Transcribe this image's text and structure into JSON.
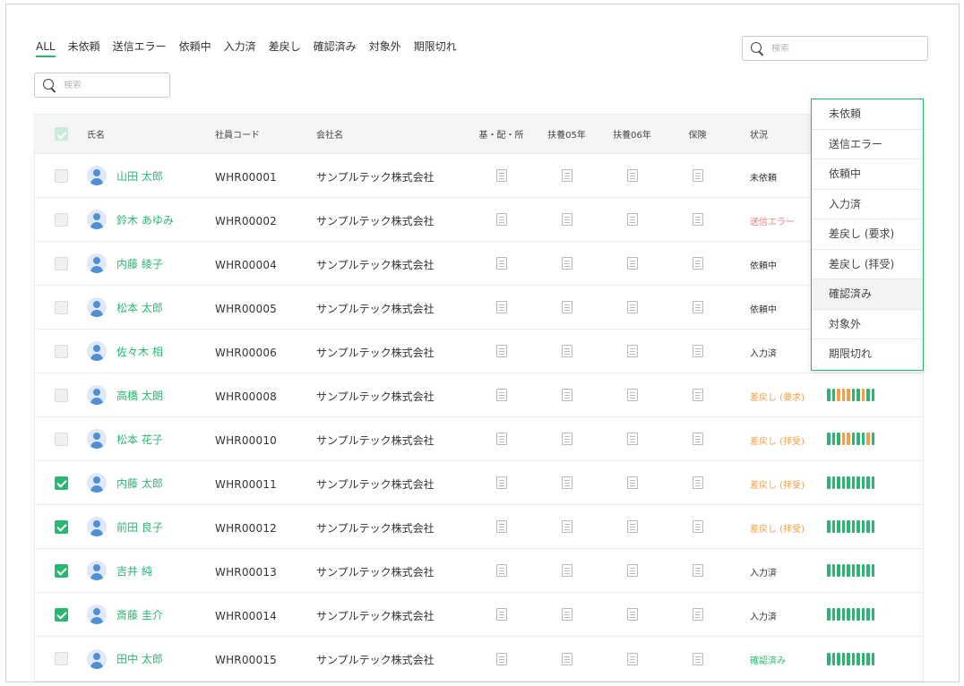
{
  "tabs": [
    "ALL",
    "未依頼",
    "送信エラー",
    "依頼中",
    "入力済",
    "差戻し",
    "確認済み",
    "対象外",
    "期限切れ"
  ],
  "active_tab": 0,
  "search_top": {
    "placeholder": "検索"
  },
  "search_left": {
    "placeholder": "検索"
  },
  "columns": {
    "name": "氏名",
    "code": "社員コード",
    "company": "会社名",
    "doc1": "基・配・所",
    "doc2": "扶養05年",
    "doc3": "扶養06年",
    "doc4": "保険",
    "status": "状況"
  },
  "colors": {
    "accent": "#2bb673",
    "error": "#f07e7e",
    "warn": "#f0a04b",
    "confirmed": "#2bb673",
    "normal": "#333333"
  },
  "icons": {
    "document": "document-icon",
    "avatar": "avatar-icon",
    "search": "search-icon"
  },
  "rows": [
    {
      "checked": false,
      "name": "山田 太郎",
      "code": "WHR00001",
      "company": "サンプルテック株式会社",
      "status": "未依頼",
      "status_type": "normal",
      "progress": null
    },
    {
      "checked": false,
      "name": "鈴木 あゆみ",
      "code": "WHR00002",
      "company": "サンプルテック株式会社",
      "status": "送信エラー",
      "status_type": "error",
      "progress": null
    },
    {
      "checked": false,
      "name": "内藤 綾子",
      "code": "WHR00004",
      "company": "サンプルテック株式会社",
      "status": "依頼中",
      "status_type": "normal",
      "progress": null
    },
    {
      "checked": false,
      "name": "松本 太郎",
      "code": "WHR00005",
      "company": "サンプルテック株式会社",
      "status": "依頼中",
      "status_type": "normal",
      "progress": null
    },
    {
      "checked": false,
      "name": "佐々木 相",
      "code": "WHR00006",
      "company": "サンプルテック株式会社",
      "status": "入力済",
      "status_type": "normal",
      "progress": null
    },
    {
      "checked": false,
      "name": "高橋 太朗",
      "code": "WHR00008",
      "company": "サンプルテック株式会社",
      "status": "差戻し (要求)",
      "status_type": "warn",
      "progress": [
        "g",
        "g",
        "o",
        "o",
        "o",
        "g",
        "g",
        "o",
        "g",
        "g"
      ]
    },
    {
      "checked": false,
      "name": "松本 花子",
      "code": "WHR00010",
      "company": "サンプルテック株式会社",
      "status": "差戻し (拝受)",
      "status_type": "warn",
      "progress": [
        "g",
        "g",
        "g",
        "o",
        "o",
        "g",
        "g",
        "g",
        "o",
        "g"
      ]
    },
    {
      "checked": true,
      "name": "内藤 太郎",
      "code": "WHR00011",
      "company": "サンプルテック株式会社",
      "status": "差戻し (拝受)",
      "status_type": "warn",
      "progress": [
        "g",
        "g",
        "g",
        "g",
        "g",
        "g",
        "g",
        "g",
        "g",
        "g"
      ]
    },
    {
      "checked": true,
      "name": "前田 良子",
      "code": "WHR00012",
      "company": "サンプルテック株式会社",
      "status": "差戻し (拝受)",
      "status_type": "warn",
      "progress": [
        "g",
        "g",
        "g",
        "g",
        "g",
        "g",
        "g",
        "g",
        "g",
        "g"
      ]
    },
    {
      "checked": true,
      "name": "吉井 純",
      "code": "WHR00013",
      "company": "サンプルテック株式会社",
      "status": "入力済",
      "status_type": "normal",
      "progress": [
        "g",
        "g",
        "g",
        "g",
        "g",
        "g",
        "g",
        "g",
        "g",
        "g"
      ]
    },
    {
      "checked": true,
      "name": "斎藤 圭介",
      "code": "WHR00014",
      "company": "サンプルテック株式会社",
      "status": "入力済",
      "status_type": "normal",
      "progress": [
        "g",
        "g",
        "g",
        "g",
        "g",
        "g",
        "g",
        "g",
        "g",
        "g"
      ]
    },
    {
      "checked": false,
      "name": "田中 太郎",
      "code": "WHR00015",
      "company": "サンプルテック株式会社",
      "status": "確認済み",
      "status_type": "confirmed",
      "progress": [
        "g",
        "g",
        "g",
        "g",
        "g",
        "g",
        "g",
        "g",
        "g",
        "g"
      ]
    }
  ],
  "status_dropdown": {
    "items": [
      "未依頼",
      "送信エラー",
      "依頼中",
      "入力済",
      "差戻し (要求)",
      "差戻し (拝受)",
      "確認済み",
      "対象外",
      "期限切れ"
    ],
    "hovered": 6
  }
}
